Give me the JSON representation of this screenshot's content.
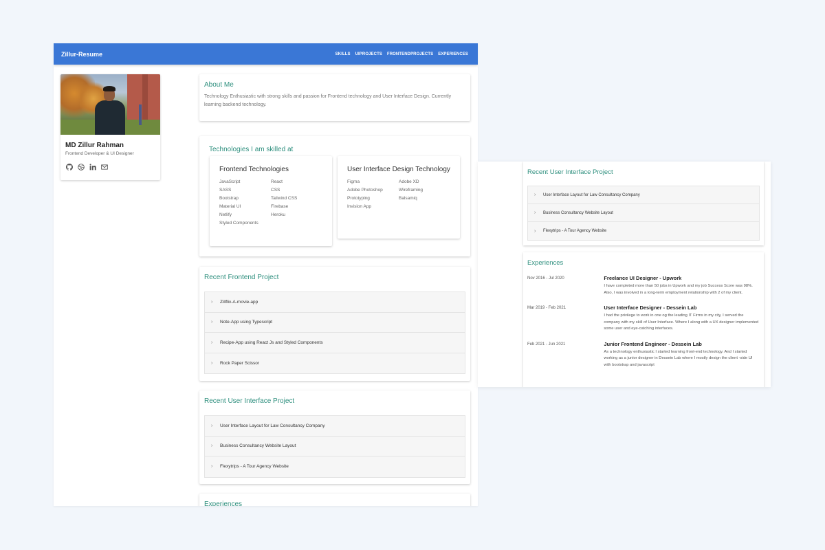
{
  "brand": "Zillur-Resume",
  "nav": [
    "SKILLS",
    "UIPROJECTS",
    "FRONTENDPROJECTS",
    "EXPERIENCES"
  ],
  "profile": {
    "name": "MD Zillur Rahman",
    "role": "Frontend Developer & UI Designer",
    "socials": [
      "github-icon",
      "dribbble-icon",
      "linkedin-icon",
      "mail-icon"
    ]
  },
  "about": {
    "title": "About Me",
    "text": "Technology Enthusiastic with strong skills and passion for Frontend technology and User Interface Design. Currently learning backend technology."
  },
  "tech": {
    "title": "Technologies I am skilled at",
    "frontend": {
      "title": "Frontend Technologies",
      "items": [
        "JavaScript",
        "React",
        "SASS",
        "CSS",
        "Bootstrap",
        "Tailwind CSS",
        "Material UI",
        "Firebase",
        "Netlify",
        "Heroku",
        "Styled Components"
      ]
    },
    "ui": {
      "title": "User Interface Design Technology",
      "items": [
        "Figma",
        "Adobe XD",
        "Adobe Photoshop",
        "Wireframing",
        "Prototyping",
        "Balsamiq",
        "Invision App"
      ]
    }
  },
  "frontend_projects": {
    "title": "Recent Frontend Project",
    "items": [
      "Zillflix-A-movie-app",
      "Note-App using Typescript",
      "Recipe-App using React Js and Styled Components",
      "Rock Paper Scissor"
    ]
  },
  "ui_projects": {
    "title": "Recent User Interface Project",
    "items": [
      "User Interface Layout for Law Consultancy Company",
      "Business Consultancy Website Layout",
      "Flexytrips - A Tour Agency Website"
    ]
  },
  "experiences": {
    "title": "Experiences",
    "items": [
      {
        "date": "Nov 2016 - Jul 2020",
        "role": "Freelance UI Designer - Upwork",
        "desc": "I have completed more than 50 jobs in Upwork and my job Success Score was 98%. Also, I was involved in a long-term employment relationship with 2 of my client."
      },
      {
        "date": "Mar 2019 - Feb 2021",
        "role": "User Interface Designer - Dessein Lab",
        "desc": "I had the privilege to work in one og the leading IT Firms in my city, I served the company with my skill of User Interface. Where I along with a UX designer implemented some user and eye-catching interfaces."
      },
      {
        "date": "Feb 2021 - Jun 2021",
        "role": "Junior Frontend Engineer - Dessein Lab",
        "desc": "As a technology enthusiastic I started learning front-end technology. And I started working as a junior designer in Dessein Lab where I mostly design the client -side UI with bootstrap and javascript"
      }
    ]
  },
  "colors": {
    "primary": "#3a77d6",
    "accent": "#2e8f7e"
  }
}
